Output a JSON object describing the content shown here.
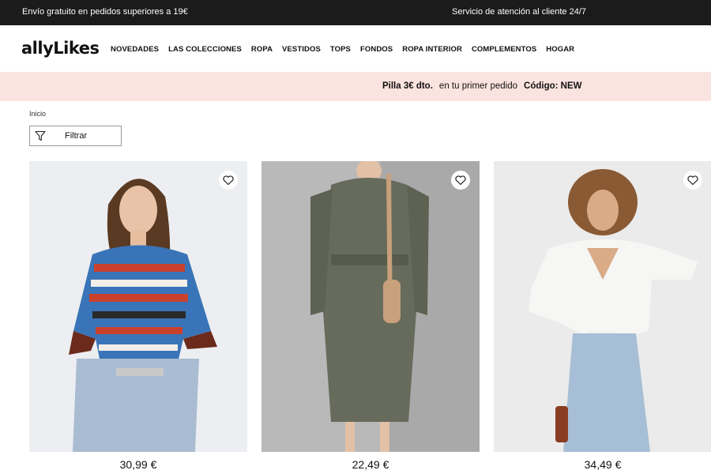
{
  "topbar": {
    "shipping": "Envío gratuito en pedidos superiores a 19€",
    "service": "Servicio de atención al cliente 24/7"
  },
  "header": {
    "logo": "allyLikes",
    "nav": [
      "NOVEDADES",
      "LAS COLECCIONES",
      "ROPA",
      "VESTIDOS",
      "TOPS",
      "FONDOS",
      "ROPA INTERIOR",
      "COMPLEMENTOS",
      "HOGAR"
    ]
  },
  "promo": {
    "offer": "Pilla 3€ dto.",
    "text": "en tu primer pedido",
    "code": "Código: NEW"
  },
  "breadcrumb": "Inicio",
  "filter": {
    "label": "Filtrar"
  },
  "products": [
    {
      "price": "30,99 €"
    },
    {
      "price": "22,49 €"
    },
    {
      "price": "34,49 €"
    }
  ],
  "colors": {
    "topbar": "#1b1b1b",
    "promo_bg": "#fbe3df"
  },
  "icons": {
    "filter": "filter-funnel-icon",
    "wishlist": "heart-icon"
  }
}
